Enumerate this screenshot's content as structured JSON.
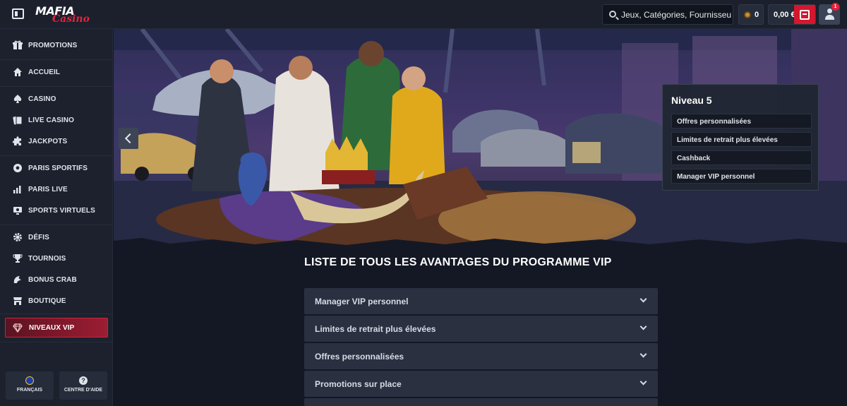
{
  "header": {
    "logo_main": "MAFIA",
    "logo_sub": "Casino",
    "search_placeholder": "Jeux, Catégories, Fournisseurs",
    "coins": "0",
    "balance": "0,00 €",
    "notifications": "1"
  },
  "sidebar": {
    "items": [
      {
        "label": "PROMOTIONS",
        "icon": "gift-icon"
      },
      {
        "label": "ACCUEIL",
        "icon": "home-icon"
      },
      {
        "label": "CASINO",
        "icon": "spade-icon"
      },
      {
        "label": "LIVE CASINO",
        "icon": "cards-icon"
      },
      {
        "label": "JACKPOTS",
        "icon": "puzzle-icon"
      },
      {
        "label": "PARIS SPORTIFS",
        "icon": "soccer-ball-icon"
      },
      {
        "label": "PARIS LIVE",
        "icon": "live-chart-icon"
      },
      {
        "label": "SPORTS VIRTUELS",
        "icon": "virtual-screen-icon"
      },
      {
        "label": "DÉFIS",
        "icon": "gear-icon"
      },
      {
        "label": "TOURNOIS",
        "icon": "trophy-icon"
      },
      {
        "label": "BONUS CRAB",
        "icon": "claw-icon"
      },
      {
        "label": "BOUTIQUE",
        "icon": "shop-icon"
      },
      {
        "label": "NIVEAUX VIP",
        "icon": "diamond-icon"
      }
    ],
    "footer": {
      "language": "FRANÇAIS",
      "help": "CENTRE D'AIDE"
    }
  },
  "hero": {
    "level_title": "Niveau 5",
    "level_perks": [
      "Offres personnalisées",
      "Limites de retrait plus élevées",
      "Cashback",
      "Manager VIP personnel"
    ]
  },
  "content": {
    "title": "LISTE DE TOUS LES AVANTAGES DU PROGRAMME VIP",
    "accordion": [
      "Manager VIP personnel",
      "Limites de retrait plus élevées",
      "Offres personnalisées",
      "Promotions sur place"
    ]
  },
  "colors": {
    "accent": "#d4172f",
    "sidebar_bg": "#1c212d",
    "page_bg": "#141824",
    "accordion_bg": "#2a3040"
  }
}
